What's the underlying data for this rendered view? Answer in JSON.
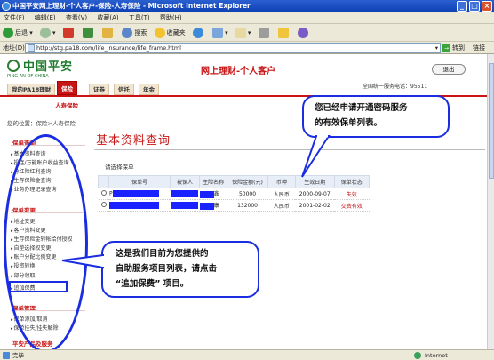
{
  "window": {
    "title": "中国平安网上理财-个人客户-保险-人寿保险 - Microsoft Internet Explorer"
  },
  "menu": [
    "文件(F)",
    "编辑(E)",
    "查看(V)",
    "收藏(A)",
    "工具(T)",
    "帮助(H)"
  ],
  "toolbar": {
    "back": "后退",
    "search": "搜索",
    "favorites": "收藏夹"
  },
  "address": {
    "label": "地址(D)",
    "url": "http://stg.pa18.com/life_insurance/life_frame.html",
    "go": "转到",
    "links": "链接"
  },
  "site": {
    "logo_cn": "中国平安",
    "logo_en": "PING AN OF CHINA",
    "title": "网上理财-个人客户",
    "exit": "退出",
    "hotline": "全国统一服务电话：95511",
    "tabs": [
      "我的PA18理财",
      "保险",
      "证券",
      "信托",
      "年金"
    ],
    "subtab": "人寿保险"
  },
  "breadcrumb": "您的位置：保险>人寿保险",
  "sidebar": {
    "sections": [
      {
        "title": "保单查询",
        "items": [
          "基本资料查询",
          "投连/万能账户收益查询",
          "分红险红利查询",
          "生存保险金查询",
          "业务办理记录查询"
        ]
      },
      {
        "title": "保单变更",
        "items": [
          "地址变更",
          "客户资料变更",
          "生存保险金转帐给付授权",
          "自垫选择权变更",
          "账户分配比例变更",
          "投资转换",
          "部分领取",
          "追加保费"
        ]
      },
      {
        "title": "保单管理",
        "items": [
          "保单添加/取消",
          "保单挂失/挂失解除"
        ]
      },
      {
        "title": "平安产品及服务",
        "items": []
      }
    ]
  },
  "main": {
    "title": "基本资料查询",
    "choose_label": "请选择保单",
    "table": {
      "headers": [
        "保单号",
        "被保人",
        "主险名称",
        "保险金额(元)",
        "币种",
        "生效日期",
        "保单状态"
      ],
      "rows": [
        {
          "policy": "P",
          "product": "鑫",
          "amount": "50000",
          "currency": "人民币",
          "date": "2000-09-07",
          "status": "失效"
        },
        {
          "product": "康",
          "amount": "132000",
          "currency": "人民币",
          "date": "2001-02-02",
          "status": "交费有效"
        }
      ]
    }
  },
  "callouts": {
    "top": [
      "您已经申请开通密码服务",
      "的有效保单列表。"
    ],
    "bottom": [
      "这是我们目前为您提供的",
      "自助服务项目列表，请点击",
      "“追加保费” 项目。"
    ]
  },
  "status": {
    "done": "完毕",
    "zone": "Internet"
  },
  "colors": {
    "brand_red": "#c81414",
    "brand_green": "#1d7a2a",
    "annotation_blue": "#1a2de0"
  }
}
